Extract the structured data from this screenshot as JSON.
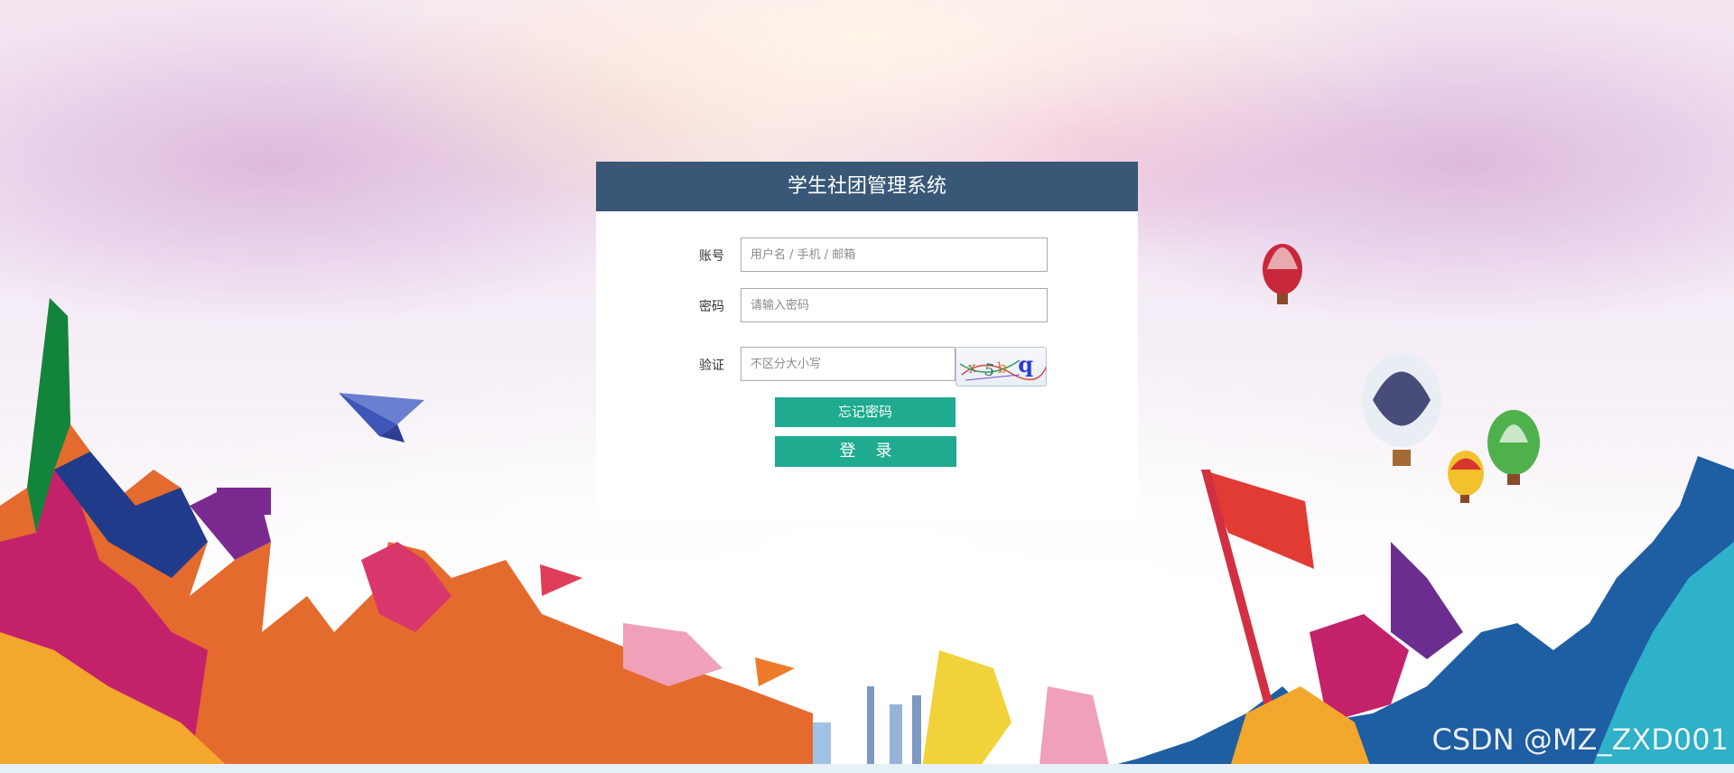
{
  "app": {
    "title": "学生社团管理系统"
  },
  "form": {
    "account_label": "账号",
    "account_placeholder": "用户名 / 手机 / 邮箱",
    "password_label": "密码",
    "password_placeholder": "请输入密码",
    "captcha_label": "验证",
    "captcha_placeholder": "不区分大小写",
    "captcha_text": "q"
  },
  "buttons": {
    "forgot_password": "忘记密码",
    "login": "登录"
  },
  "watermark": "CSDN @MZ_ZXD001",
  "colors": {
    "header": "#395878",
    "button": "#1fab8f"
  }
}
